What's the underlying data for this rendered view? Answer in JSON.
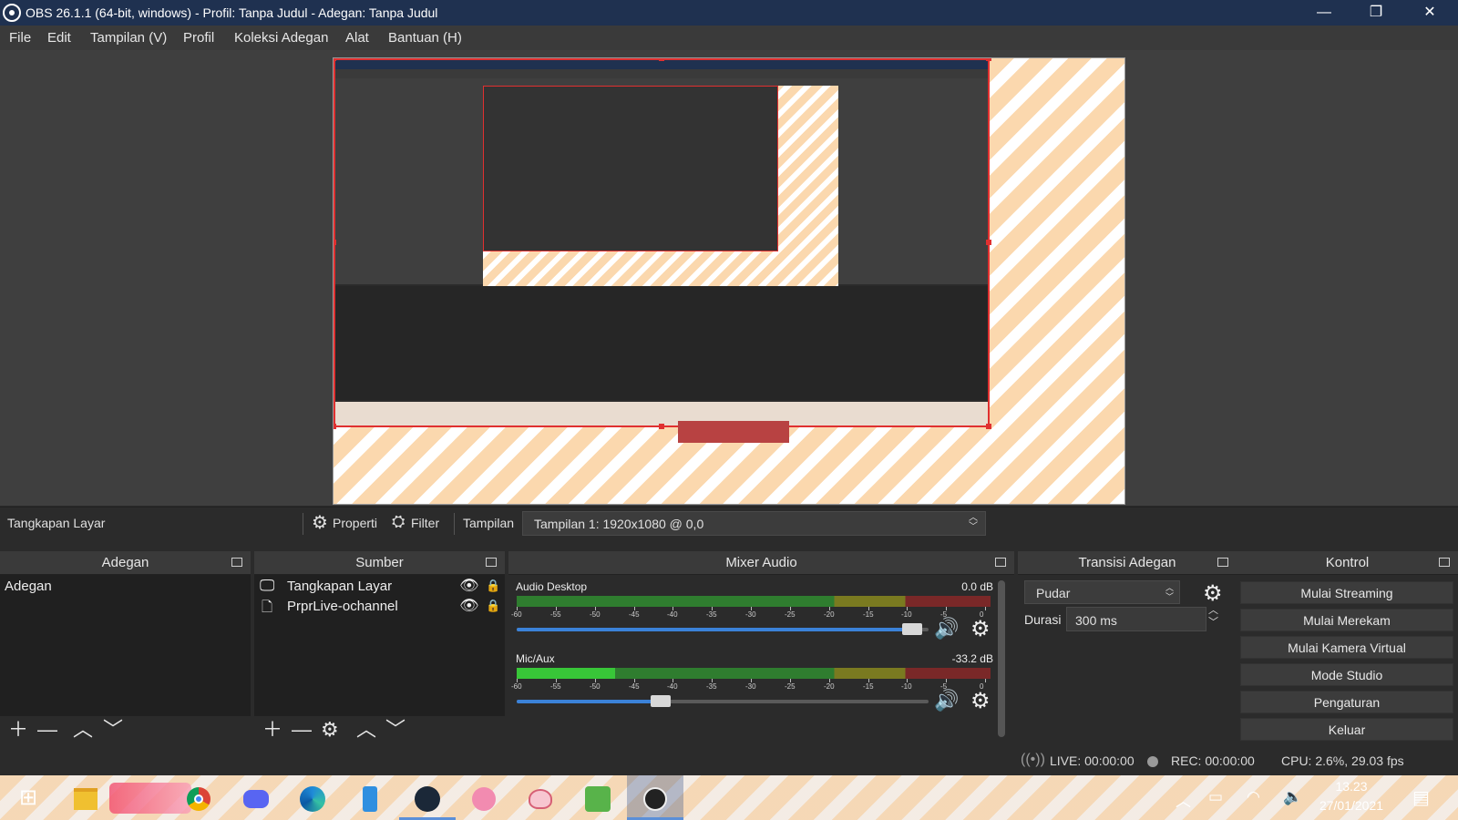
{
  "window": {
    "title": "OBS 26.1.1 (64-bit, windows) - Profil: Tanpa Judul - Adegan: Tanpa Judul",
    "minimize": "—",
    "restore": "❐",
    "close": "✕"
  },
  "menu": [
    "File",
    "Edit",
    "Tampilan (V)",
    "Profil",
    "Koleksi Adegan",
    "Alat",
    "Bantuan (H)"
  ],
  "source_toolbar": {
    "source_name": "Tangkapan Layar",
    "properties": "Properti",
    "filter": "Filter",
    "display_label": "Tampilan",
    "display_value": "Tampilan 1: 1920x1080 @ 0,0"
  },
  "scenes": {
    "header": "Adegan",
    "items": [
      "Adegan"
    ]
  },
  "sources": {
    "header": "Sumber",
    "items": [
      "Tangkapan Layar",
      "PrprLive-ochannel"
    ]
  },
  "mixer": {
    "header": "Mixer Audio",
    "channels": [
      {
        "name": "Audio Desktop",
        "db": "0.0 dB",
        "volume_level": 0.96
      },
      {
        "name": "Mic/Aux",
        "db": "-33.2 dB",
        "volume_level": 0.35
      }
    ],
    "ticks": [
      "-60",
      "-55",
      "-50",
      "-45",
      "-40",
      "-35",
      "-30",
      "-25",
      "-20",
      "-15",
      "-10",
      "-5",
      "0"
    ]
  },
  "transitions": {
    "header": "Transisi Adegan",
    "selected": "Pudar",
    "duration_label": "Durasi",
    "duration_value": "300 ms"
  },
  "controls": {
    "header": "Kontrol",
    "buttons": [
      "Mulai Streaming",
      "Mulai Merekam",
      "Mulai Kamera Virtual",
      "Mode Studio",
      "Pengaturan",
      "Keluar"
    ]
  },
  "status": {
    "live": "LIVE: 00:00:00",
    "rec": "REC: 00:00:00",
    "cpu": "CPU: 2.6%, 29.03 fps"
  },
  "taskbar": {
    "time": "13.23",
    "date": "27/01/2021",
    "apps": [
      "file-explorer",
      "chrome",
      "discord",
      "edge",
      "phone",
      "steam",
      "pink-character",
      "flower-app",
      "android-app",
      "obs"
    ]
  },
  "colors": {
    "titlebar": "#1f3150",
    "panel": "#2b2b2b",
    "accent_blue": "#3b82d8",
    "meter_green": "#3ad23a",
    "selection_red": "#e03030"
  }
}
